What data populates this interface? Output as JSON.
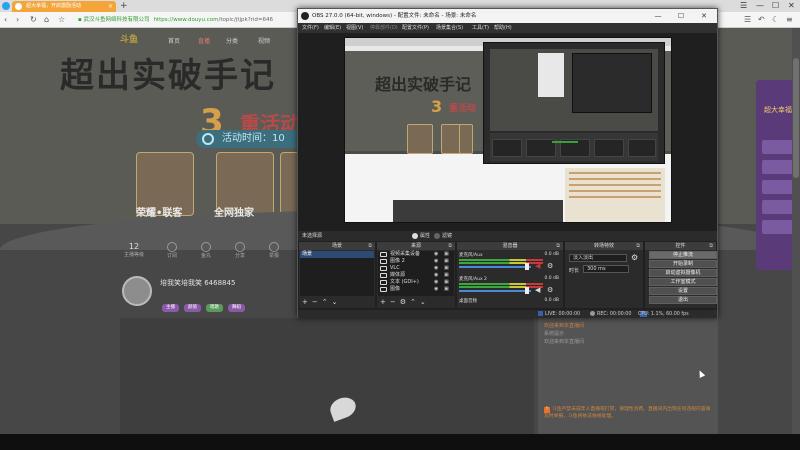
{
  "browser": {
    "tab_title": "超大幸福，开启激励活动",
    "new_tab": "+",
    "url_org": "武汉斗鱼网络科技有限公司",
    "url_host": "https://www.douyu.com",
    "url_path": "/topic/jtjpk?rid=646",
    "controls": [
      "☰",
      "—",
      "☐",
      "✕"
    ]
  },
  "page": {
    "logo": "斗鱼",
    "nav": [
      "首页",
      "直播",
      "分类",
      "视频"
    ],
    "hero_title": "超出实破手记",
    "hero_number": "3",
    "hero_subtitle": "重活动",
    "time_label": "活动时间：10",
    "cards": [
      "荣耀•联客",
      "全网独家"
    ],
    "stats": [
      {
        "value": "12",
        "label": "主播等级"
      },
      {
        "value": "",
        "label": "订阅"
      },
      {
        "value": "",
        "label": "鱼丸"
      },
      {
        "value": "",
        "label": "分享"
      },
      {
        "value": "",
        "label": "举报"
      }
    ],
    "streamer_name": "培我笑培我笑 6468845",
    "tags": [
      "主播",
      "颜值",
      "唱歌",
      "舞蹈"
    ],
    "chat_lines": [
      "欢迎来到本直播间",
      "系统提示",
      "欢迎来到本直播间"
    ],
    "chat_notice": "斗鱼严禁未成年人直播或打赏，请理性消费。直播间内出现任何违规内容请及时举报，斗鱼将依法依规处理。",
    "side_banner_title": "超大幸福"
  },
  "obs": {
    "title": "OBS 27.0.0 (64-bit, windows) - 配置文件: 未命名 - 场景: 未命名",
    "window_controls": [
      "—",
      "☐",
      "✕"
    ],
    "menu": [
      "文件(F)",
      "编辑(E)",
      "视图(V)",
      "停靠部件(D)",
      "配置文件(P)",
      "场景集合(S)",
      "工具(T)",
      "帮助(H)"
    ],
    "current_scene_label": "未选择源",
    "preview_modes": [
      "属性",
      "滤镜"
    ],
    "docks": {
      "scenes": {
        "title": "场景",
        "items": [
          "场景"
        ]
      },
      "sources": {
        "title": "来源",
        "items": [
          "视频采集设备",
          "图像 2",
          "VLC",
          "媒体源",
          "文本 (GDI+)",
          "图像"
        ]
      },
      "mixer": {
        "title": "混音器",
        "channels": [
          {
            "name": "麦克风/Aux",
            "db": "0.0 dB"
          },
          {
            "name": "麦克风/Aux 2",
            "db": "0.0 dB"
          },
          {
            "name": "桌面音频",
            "db": "0.0 dB"
          }
        ]
      },
      "transitions": {
        "title": "转场特效",
        "selected": "淡入淡出",
        "duration_label": "时长",
        "duration_value": "300 ms"
      },
      "controls": {
        "title": "控件",
        "buttons": [
          "停止推流",
          "开始录制",
          "启动虚拟摄像机",
          "工作室模式",
          "设置",
          "退出"
        ]
      }
    },
    "toolbar_glyphs": [
      "+",
      "−",
      "⌃",
      "⌄",
      "⚙"
    ],
    "status": {
      "live": "LIVE: 00:00:00",
      "rec": "REC: 00:00:00",
      "cpu": "CPU: 1.1%, 60.00 fps"
    }
  },
  "colors": {
    "browser_tab": "#f4a53a",
    "obs_bg": "#2b2b2b",
    "selected_scene": "#2d4a74",
    "meter_green": "#3ea63e",
    "meter_red": "#c83a3a",
    "url_green": "#2e9b2e"
  }
}
